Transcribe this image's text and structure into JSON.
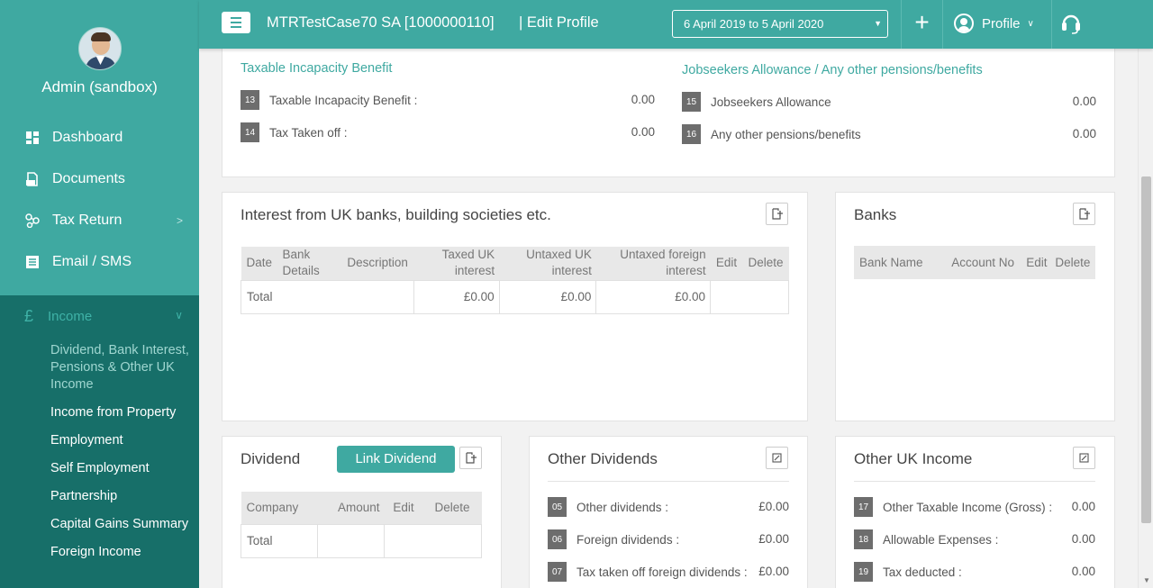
{
  "sidebar": {
    "admin_name": "Admin (sandbox)",
    "nav": [
      {
        "label": "Dashboard",
        "icon": "dashboard-icon"
      },
      {
        "label": "Documents",
        "icon": "documents-icon"
      },
      {
        "label": "Tax Return",
        "icon": "tax-return-icon"
      },
      {
        "label": "Email / SMS",
        "icon": "email-icon"
      }
    ],
    "income_label": "Income",
    "income_icon": "£",
    "submenu": [
      "Dividend, Bank Interest, Pensions & Other UK Income",
      "Income from Property",
      "Employment",
      "Self Employment",
      "Partnership",
      "Capital Gains Summary",
      "Foreign Income"
    ]
  },
  "topbar": {
    "client": "MTRTestCase70 SA [1000000110]",
    "edit_profile": "| Edit Profile",
    "period": "6 April 2019 to 5 April 2020",
    "plus": "+",
    "profile": "Profile"
  },
  "incapacity": {
    "title": "Taxable Incapacity Benefit",
    "rows": [
      {
        "num": "13",
        "label": "Taxable Incapacity Benefit :",
        "value": "0.00"
      },
      {
        "num": "14",
        "label": "Tax Taken off :",
        "value": "0.00"
      }
    ]
  },
  "jobseekers": {
    "title": "Jobseekers Allowance / Any other pensions/benefits",
    "rows": [
      {
        "num": "15",
        "label": "Jobseekers Allowance",
        "value": "0.00"
      },
      {
        "num": "16",
        "label": "Any other pensions/benefits",
        "value": "0.00"
      }
    ]
  },
  "interest": {
    "title": "Interest from UK banks, building societies etc.",
    "headers": [
      "Date",
      "Bank Details",
      "Description",
      "Taxed UK interest",
      "Untaxed UK interest",
      "Untaxed foreign interest",
      "Edit",
      "Delete"
    ],
    "total_label": "Total",
    "totals": [
      "£0.00",
      "£0.00",
      "£0.00"
    ]
  },
  "banks": {
    "title": "Banks",
    "headers": [
      "Bank Name",
      "Account No",
      "Edit",
      "Delete"
    ]
  },
  "dividend": {
    "title": "Dividend",
    "link_label": "Link Dividend",
    "headers": [
      "Company",
      "Amount",
      "Edit",
      "Delete"
    ],
    "total_label": "Total"
  },
  "other_dividends": {
    "title": "Other Dividends",
    "rows": [
      {
        "num": "05",
        "label": "Other dividends :",
        "value": "£0.00"
      },
      {
        "num": "06",
        "label": "Foreign dividends :",
        "value": "£0.00"
      },
      {
        "num": "07",
        "label": "Tax taken off foreign dividends :",
        "value": "£0.00"
      }
    ]
  },
  "other_uk_income": {
    "title": "Other UK Income",
    "rows": [
      {
        "num": "17",
        "label": "Other Taxable Income (Gross) :",
        "value": "0.00"
      },
      {
        "num": "18",
        "label": "Allowable Expenses :",
        "value": "0.00"
      },
      {
        "num": "19",
        "label": "Tax deducted :",
        "value": "0.00"
      }
    ]
  },
  "colors": {
    "teal": "#3fa9a1",
    "dark_teal": "#176f69",
    "box_grey": "#6d6d6d"
  }
}
